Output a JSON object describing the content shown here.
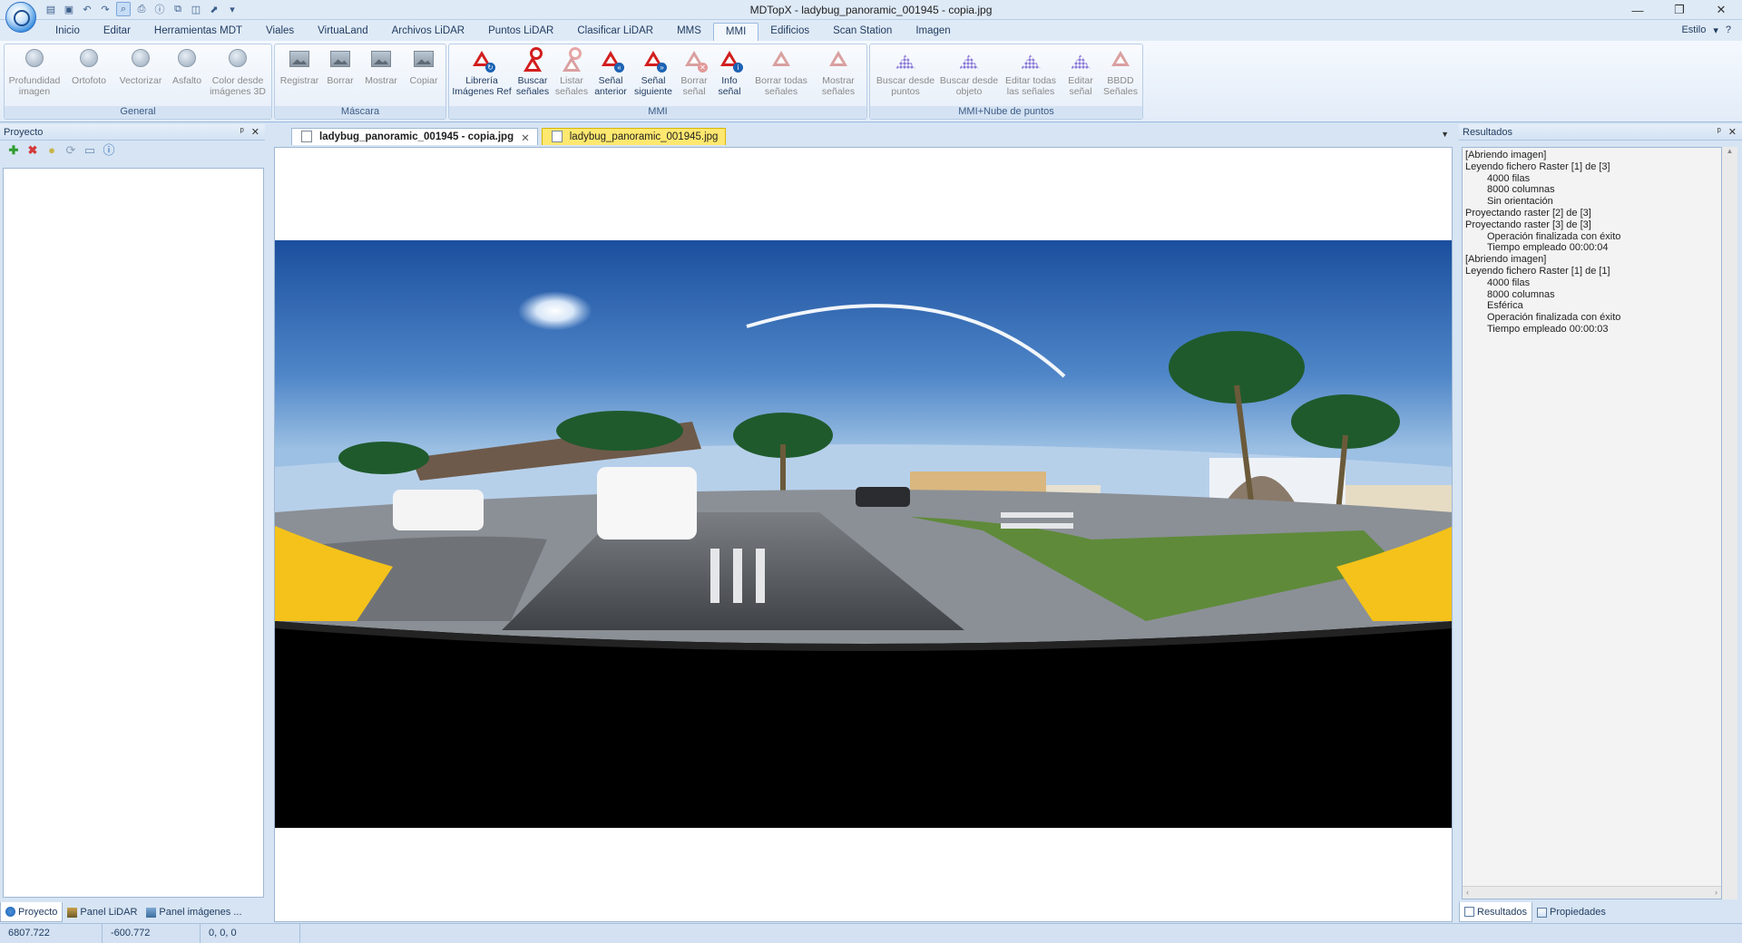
{
  "window": {
    "title": "MDTopX - ladybug_panoramic_001945 - copia.jpg",
    "minimize": "—",
    "restore": "❐",
    "close": "✕"
  },
  "quick_access": [
    "open-icon",
    "save-icon",
    "undo-icon",
    "redo-icon",
    "zoom-icon",
    "print-icon",
    "info-icon",
    "copy-icon",
    "layers-icon",
    "export-icon",
    "dropdown-icon"
  ],
  "ribbon": {
    "tabs": [
      "Inicio",
      "Editar",
      "Herramientas MDT",
      "Viales",
      "VirtuaLand",
      "Archivos LiDAR",
      "Puntos LiDAR",
      "Clasificar LiDAR",
      "MMS",
      "MMI",
      "Edificios",
      "Scan Station",
      "Imagen"
    ],
    "active_tab": "MMI",
    "style_label": "Estilo",
    "style_arrow": "▾",
    "help_icon": "?",
    "groups": {
      "general": {
        "title": "General",
        "buttons": [
          {
            "line1": "Profundidad",
            "line2": "imagen"
          },
          {
            "line1": "Ortofoto",
            "line2": ""
          },
          {
            "line1": "Vectorizar",
            "line2": ""
          },
          {
            "line1": "Asfalto",
            "line2": ""
          },
          {
            "line1": "Color desde",
            "line2": "imágenes 3D"
          }
        ]
      },
      "mascara": {
        "title": "Máscara",
        "buttons": [
          {
            "line1": "Registrar",
            "line2": ""
          },
          {
            "line1": "Borrar",
            "line2": ""
          },
          {
            "line1": "Mostrar",
            "line2": ""
          },
          {
            "line1": "Copiar",
            "line2": ""
          }
        ]
      },
      "mmi": {
        "title": "MMI",
        "buttons": [
          {
            "line1": "Librería",
            "line2": "Imágenes Ref"
          },
          {
            "line1": "Buscar",
            "line2": "señales"
          },
          {
            "line1": "Listar",
            "line2": "señales"
          },
          {
            "line1": "Señal",
            "line2": "anterior"
          },
          {
            "line1": "Señal",
            "line2": "siguiente"
          },
          {
            "line1": "Borrar",
            "line2": "señal"
          },
          {
            "line1": "Info",
            "line2": "señal"
          },
          {
            "line1": "Borrar todas",
            "line2": "señales"
          },
          {
            "line1": "Mostrar",
            "line2": "señales"
          }
        ]
      },
      "mmi_nube": {
        "title": "MMI+Nube de puntos",
        "buttons": [
          {
            "line1": "Buscar desde",
            "line2": "puntos"
          },
          {
            "line1": "Buscar desde",
            "line2": "objeto"
          },
          {
            "line1": "Editar todas",
            "line2": "las señales"
          },
          {
            "line1": "Editar",
            "line2": "señal"
          },
          {
            "line1": "BBDD",
            "line2": "Señales"
          }
        ]
      }
    }
  },
  "left_panel": {
    "title": "Proyecto",
    "pin": "ᵖ",
    "close": "✕",
    "tools": [
      "add-icon",
      "delete-icon",
      "light-icon",
      "refresh-icon",
      "image-icon",
      "info-icon"
    ],
    "bottom_tabs": [
      "Proyecto",
      "Panel LiDAR",
      "Panel imágenes ..."
    ]
  },
  "documents": {
    "tabs": [
      {
        "label": "ladybug_panoramic_001945 - copia.jpg",
        "close": "✕"
      },
      {
        "label": "ladybug_panoramic_001945.jpg",
        "close": ""
      }
    ],
    "active_tab_index": 1,
    "dropdown": "▼"
  },
  "results_panel": {
    "title": "Resultados",
    "pin": "ᵖ",
    "close": "✕",
    "lines": [
      {
        "text": "[Abriendo imagen]",
        "indent": false
      },
      {
        "text": "Leyendo fichero Raster [1] de [3]",
        "indent": false
      },
      {
        "text": "4000 filas",
        "indent": true
      },
      {
        "text": "8000 columnas",
        "indent": true
      },
      {
        "text": "Sin orientación",
        "indent": true
      },
      {
        "text": "Proyectando raster [2] de [3]",
        "indent": false
      },
      {
        "text": "Proyectando raster [3] de [3]",
        "indent": false
      },
      {
        "text": "Operación finalizada con éxito",
        "indent": true
      },
      {
        "text": "Tiempo empleado 00:00:04",
        "indent": true
      },
      {
        "text": "[Abriendo imagen]",
        "indent": false
      },
      {
        "text": "Leyendo fichero Raster [1] de [1]",
        "indent": false
      },
      {
        "text": "4000 filas",
        "indent": true
      },
      {
        "text": "8000 columnas",
        "indent": true
      },
      {
        "text": "Esférica",
        "indent": true
      },
      {
        "text": "Operación finalizada con éxito",
        "indent": true
      },
      {
        "text": "Tiempo empleado 00:00:03",
        "indent": true
      }
    ],
    "bottom_tabs": [
      "Resultados",
      "Propiedades"
    ]
  },
  "status_bar": {
    "x": "6807.722",
    "y": "-600.772",
    "rgb": "0,  0,  0"
  },
  "colors": {
    "accent": "#2b7cd3",
    "sign_red": "#d21e1e",
    "active_doc_tab": "#ffe86f"
  }
}
